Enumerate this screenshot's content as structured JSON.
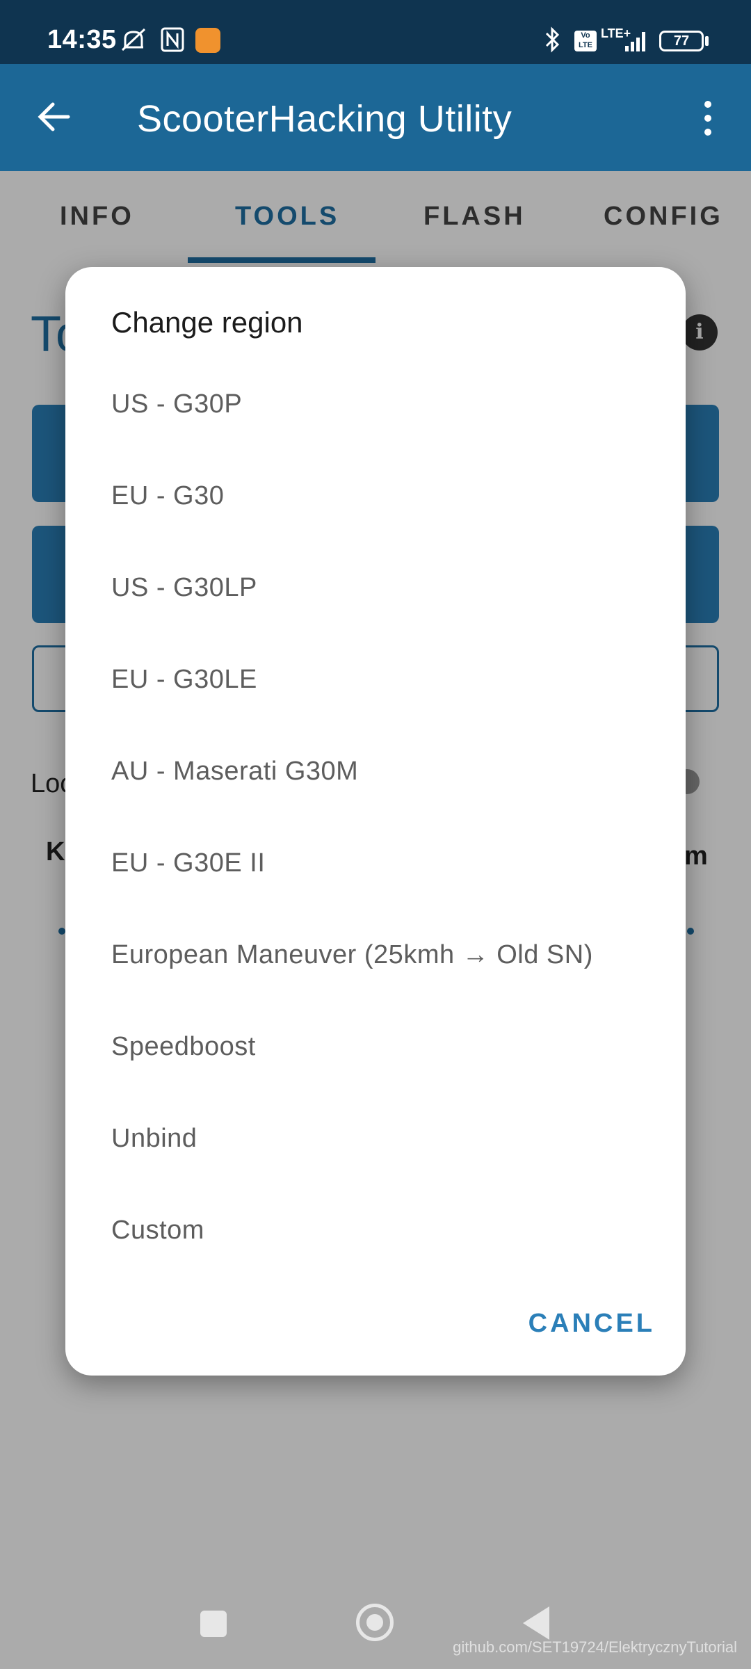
{
  "status_bar": {
    "time": "14:35",
    "network": "LTE+",
    "volte": "Vo LTE",
    "battery": "77",
    "icons": [
      "mute-bell-icon",
      "nfc-icon",
      "app-notification-icon",
      "bluetooth-icon",
      "volte-icon",
      "signal-icon",
      "battery-icon"
    ]
  },
  "app_bar": {
    "title": "ScooterHacking Utility",
    "icons": [
      "back-arrow-icon",
      "overflow-menu-icon"
    ]
  },
  "tabs": [
    {
      "label": "INFO",
      "active": false
    },
    {
      "label": "TOOLS",
      "active": true
    },
    {
      "label": "FLASH",
      "active": false
    },
    {
      "label": "CONFIG",
      "active": false
    }
  ],
  "background": {
    "title_fragment": "To",
    "row_label_1": "Loc",
    "row_label_2": "K",
    "row_label_3": "m"
  },
  "dialog": {
    "title": "Change region",
    "options": [
      "US - G30P",
      "EU - G30",
      "US - G30LP",
      "EU - G30LE",
      "AU - Maserati G30M",
      "EU - G30E II",
      "European Maneuver (25kmh → Old SN)",
      "Speedboost",
      "Unbind",
      "Custom"
    ],
    "cancel_label": "CANCEL"
  },
  "watermark": "github.com/SET19724/ElektrycznyTutorial",
  "colors": {
    "status_bar": "#0f3450",
    "app_bar": "#1c6796",
    "accent": "#2b7fb8",
    "dialog_bg": "#ffffff"
  }
}
